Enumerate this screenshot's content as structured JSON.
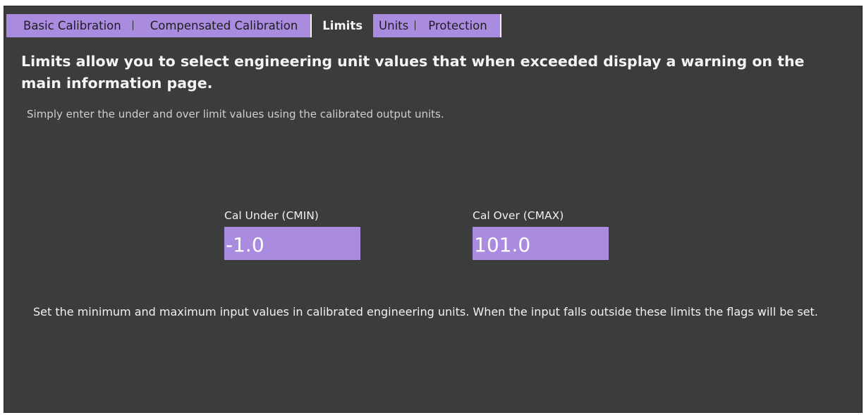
{
  "tabs": {
    "basic_calibration": "Basic Calibration",
    "compensated_calibration": "Compensated Calibration",
    "limits": "Limits",
    "units": "Units",
    "protection": "Protection"
  },
  "content": {
    "headline": "Limits allow you to select engineering unit values that when exceeded display a warning on the main information page.",
    "subtext": "Simply enter the under and over limit values using the calibrated output units.",
    "cal_under": {
      "label": "Cal Under (CMIN)",
      "value": "-1.0"
    },
    "cal_over": {
      "label": "Cal Over (CMAX)",
      "value": "101.0"
    },
    "footer": "Set the minimum and maximum input values in calibrated engineering units. When the input falls outside these limits the flags will be set."
  },
  "colors": {
    "panel_background": "#3c3c3c",
    "accent_purple": "#a98be0",
    "text_light": "#f4f4f4"
  }
}
